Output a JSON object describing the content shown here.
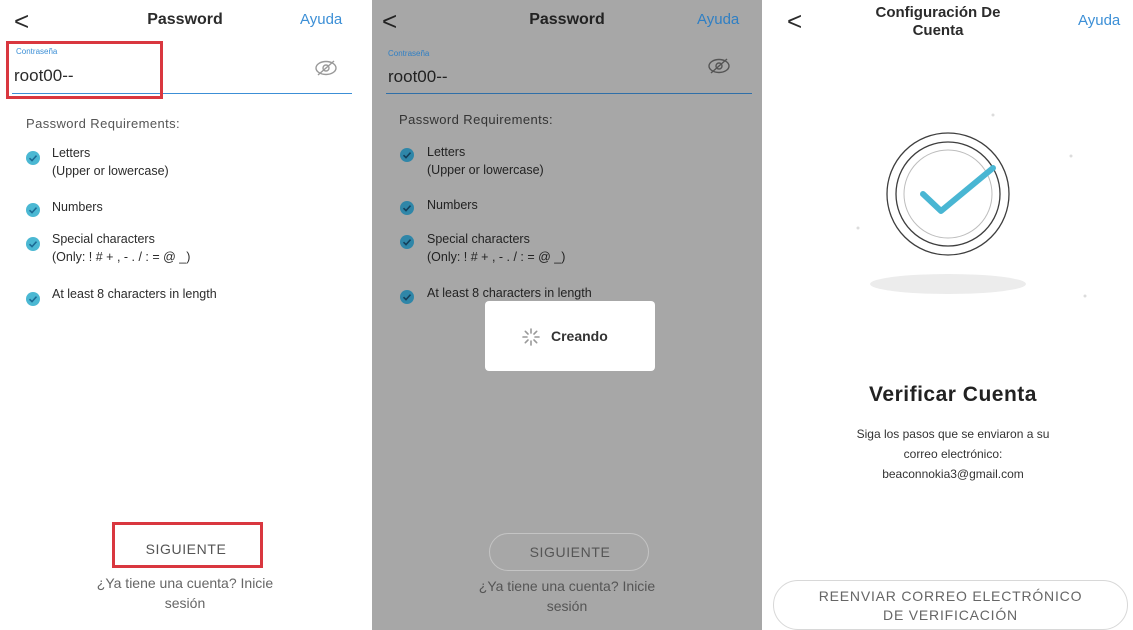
{
  "colors": {
    "accent": "#3c8fd6",
    "check": "#4bb8d3",
    "highlight": "#d9373f",
    "overlay": "#a7a7a7"
  },
  "screen1": {
    "back_glyph": "<",
    "title": "Password",
    "help": "Ayuda",
    "field_label": "Contraseña",
    "field_value": "root00--",
    "eye_icon": "eye-off-icon",
    "requirements_title": "Password Requirements:",
    "requirements": [
      {
        "line1": "Letters",
        "line2": "(Upper or lowercase)"
      },
      {
        "line1": "Numbers",
        "line2": ""
      },
      {
        "line1": "Special characters",
        "line2": "(Only: ! # + , - . / : = @ _)"
      },
      {
        "line1": "At least 8 characters in length",
        "line2": ""
      }
    ],
    "next_button": "SIGUIENTE",
    "login_line1": "¿Ya tiene una cuenta? Inicie",
    "login_line2": "sesión"
  },
  "screen2": {
    "back_glyph": "<",
    "title": "Password",
    "help": "Ayuda",
    "field_label": "Contraseña",
    "field_value": "root00--",
    "eye_icon": "eye-off-icon",
    "requirements_title": "Password Requirements:",
    "requirements": [
      {
        "line1": "Letters",
        "line2": "(Upper or lowercase)"
      },
      {
        "line1": "Numbers",
        "line2": ""
      },
      {
        "line1": "Special characters",
        "line2": "(Only: ! # + , - . / : = @ _)"
      },
      {
        "line1": "At least 8 characters in length",
        "line2": ""
      }
    ],
    "loading_text": "Creando",
    "spinner_icon": "spinner-icon",
    "next_button": "SIGUIENTE",
    "login_line1": "¿Ya tiene una cuenta? Inicie",
    "login_line2": "sesión"
  },
  "screen3": {
    "back_glyph": "<",
    "title_line1": "Configuración De",
    "title_line2": "Cuenta",
    "help": "Ayuda",
    "check_icon": "check-circle-icon",
    "heading": "Verificar Cuenta",
    "desc_line1": "Siga los pasos que se enviaron a su",
    "desc_line2": "correo electrónico:",
    "email": "beaconnokia3@gmail.com",
    "resend_line1": "REENVIAR CORREO ELECTRÓNICO",
    "resend_line2": "DE VERIFICACIÓN"
  }
}
